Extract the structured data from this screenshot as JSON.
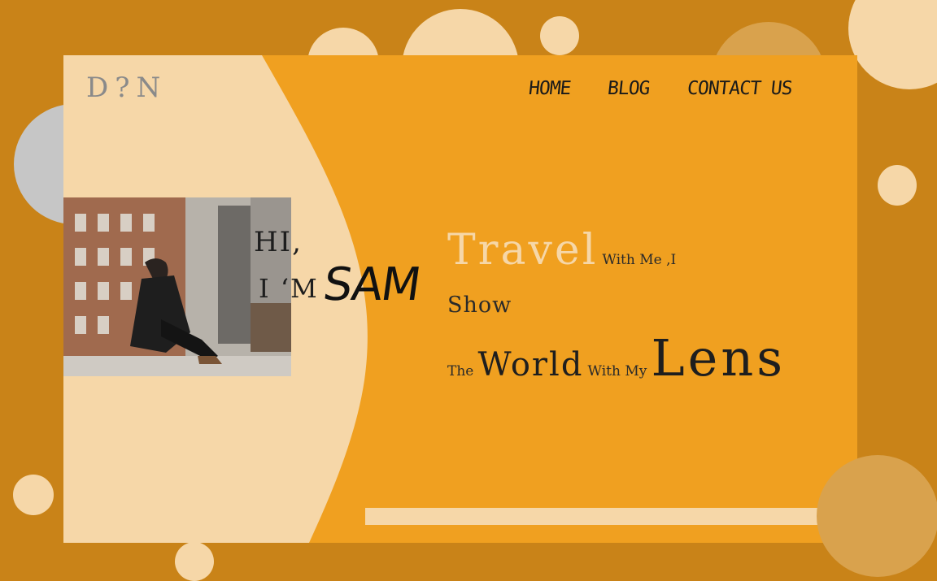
{
  "brand": {
    "logo": "D?N"
  },
  "nav": {
    "items": [
      "HOME",
      "BLOG",
      "CONTACT US"
    ]
  },
  "hero": {
    "greeting_line1": "HI,",
    "greeting_line2": "I ‘M",
    "name": "SAM"
  },
  "tagline": {
    "w1": "Travel",
    "w2": "With Me ,I",
    "w3": "Show",
    "w4": "The",
    "w5": "World",
    "w6": "With My",
    "w7": "Lens"
  },
  "colors": {
    "background": "#c98318",
    "card": "#f0a020",
    "cream": "#f6d7a8",
    "grey": "#c6c6c6"
  }
}
